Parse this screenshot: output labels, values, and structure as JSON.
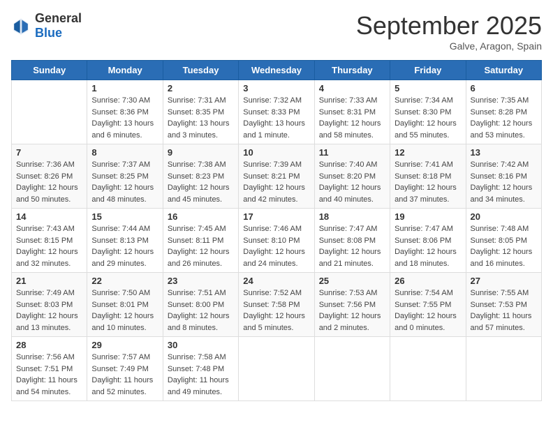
{
  "header": {
    "logo_general": "General",
    "logo_blue": "Blue",
    "month_title": "September 2025",
    "location": "Galve, Aragon, Spain"
  },
  "days_of_week": [
    "Sunday",
    "Monday",
    "Tuesday",
    "Wednesday",
    "Thursday",
    "Friday",
    "Saturday"
  ],
  "weeks": [
    [
      {
        "day": "",
        "info": ""
      },
      {
        "day": "1",
        "info": "Sunrise: 7:30 AM\nSunset: 8:36 PM\nDaylight: 13 hours\nand 6 minutes."
      },
      {
        "day": "2",
        "info": "Sunrise: 7:31 AM\nSunset: 8:35 PM\nDaylight: 13 hours\nand 3 minutes."
      },
      {
        "day": "3",
        "info": "Sunrise: 7:32 AM\nSunset: 8:33 PM\nDaylight: 13 hours\nand 1 minute."
      },
      {
        "day": "4",
        "info": "Sunrise: 7:33 AM\nSunset: 8:31 PM\nDaylight: 12 hours\nand 58 minutes."
      },
      {
        "day": "5",
        "info": "Sunrise: 7:34 AM\nSunset: 8:30 PM\nDaylight: 12 hours\nand 55 minutes."
      },
      {
        "day": "6",
        "info": "Sunrise: 7:35 AM\nSunset: 8:28 PM\nDaylight: 12 hours\nand 53 minutes."
      }
    ],
    [
      {
        "day": "7",
        "info": "Sunrise: 7:36 AM\nSunset: 8:26 PM\nDaylight: 12 hours\nand 50 minutes."
      },
      {
        "day": "8",
        "info": "Sunrise: 7:37 AM\nSunset: 8:25 PM\nDaylight: 12 hours\nand 48 minutes."
      },
      {
        "day": "9",
        "info": "Sunrise: 7:38 AM\nSunset: 8:23 PM\nDaylight: 12 hours\nand 45 minutes."
      },
      {
        "day": "10",
        "info": "Sunrise: 7:39 AM\nSunset: 8:21 PM\nDaylight: 12 hours\nand 42 minutes."
      },
      {
        "day": "11",
        "info": "Sunrise: 7:40 AM\nSunset: 8:20 PM\nDaylight: 12 hours\nand 40 minutes."
      },
      {
        "day": "12",
        "info": "Sunrise: 7:41 AM\nSunset: 8:18 PM\nDaylight: 12 hours\nand 37 minutes."
      },
      {
        "day": "13",
        "info": "Sunrise: 7:42 AM\nSunset: 8:16 PM\nDaylight: 12 hours\nand 34 minutes."
      }
    ],
    [
      {
        "day": "14",
        "info": "Sunrise: 7:43 AM\nSunset: 8:15 PM\nDaylight: 12 hours\nand 32 minutes."
      },
      {
        "day": "15",
        "info": "Sunrise: 7:44 AM\nSunset: 8:13 PM\nDaylight: 12 hours\nand 29 minutes."
      },
      {
        "day": "16",
        "info": "Sunrise: 7:45 AM\nSunset: 8:11 PM\nDaylight: 12 hours\nand 26 minutes."
      },
      {
        "day": "17",
        "info": "Sunrise: 7:46 AM\nSunset: 8:10 PM\nDaylight: 12 hours\nand 24 minutes."
      },
      {
        "day": "18",
        "info": "Sunrise: 7:47 AM\nSunset: 8:08 PM\nDaylight: 12 hours\nand 21 minutes."
      },
      {
        "day": "19",
        "info": "Sunrise: 7:47 AM\nSunset: 8:06 PM\nDaylight: 12 hours\nand 18 minutes."
      },
      {
        "day": "20",
        "info": "Sunrise: 7:48 AM\nSunset: 8:05 PM\nDaylight: 12 hours\nand 16 minutes."
      }
    ],
    [
      {
        "day": "21",
        "info": "Sunrise: 7:49 AM\nSunset: 8:03 PM\nDaylight: 12 hours\nand 13 minutes."
      },
      {
        "day": "22",
        "info": "Sunrise: 7:50 AM\nSunset: 8:01 PM\nDaylight: 12 hours\nand 10 minutes."
      },
      {
        "day": "23",
        "info": "Sunrise: 7:51 AM\nSunset: 8:00 PM\nDaylight: 12 hours\nand 8 minutes."
      },
      {
        "day": "24",
        "info": "Sunrise: 7:52 AM\nSunset: 7:58 PM\nDaylight: 12 hours\nand 5 minutes."
      },
      {
        "day": "25",
        "info": "Sunrise: 7:53 AM\nSunset: 7:56 PM\nDaylight: 12 hours\nand 2 minutes."
      },
      {
        "day": "26",
        "info": "Sunrise: 7:54 AM\nSunset: 7:55 PM\nDaylight: 12 hours\nand 0 minutes."
      },
      {
        "day": "27",
        "info": "Sunrise: 7:55 AM\nSunset: 7:53 PM\nDaylight: 11 hours\nand 57 minutes."
      }
    ],
    [
      {
        "day": "28",
        "info": "Sunrise: 7:56 AM\nSunset: 7:51 PM\nDaylight: 11 hours\nand 54 minutes."
      },
      {
        "day": "29",
        "info": "Sunrise: 7:57 AM\nSunset: 7:49 PM\nDaylight: 11 hours\nand 52 minutes."
      },
      {
        "day": "30",
        "info": "Sunrise: 7:58 AM\nSunset: 7:48 PM\nDaylight: 11 hours\nand 49 minutes."
      },
      {
        "day": "",
        "info": ""
      },
      {
        "day": "",
        "info": ""
      },
      {
        "day": "",
        "info": ""
      },
      {
        "day": "",
        "info": ""
      }
    ]
  ]
}
